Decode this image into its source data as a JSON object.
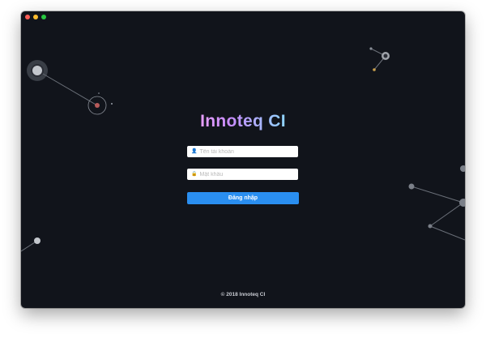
{
  "app": {
    "title": "Innoteq CI"
  },
  "login": {
    "username_placeholder": "Tên tài khoản",
    "password_placeholder": "Mật khẩu",
    "submit_label": "Đăng nhập",
    "username_icon": "user-icon",
    "password_icon": "lock-icon"
  },
  "footer": {
    "copyright": "© 2018 Innoteq CI"
  },
  "colors": {
    "background": "#11141b",
    "accent": "#2a8ef0",
    "title_gradient_start": "#e9a0ff",
    "title_gradient_end": "#8fd6ff",
    "particle_node": "#8a8f98",
    "particle_line": "#6b7079"
  }
}
